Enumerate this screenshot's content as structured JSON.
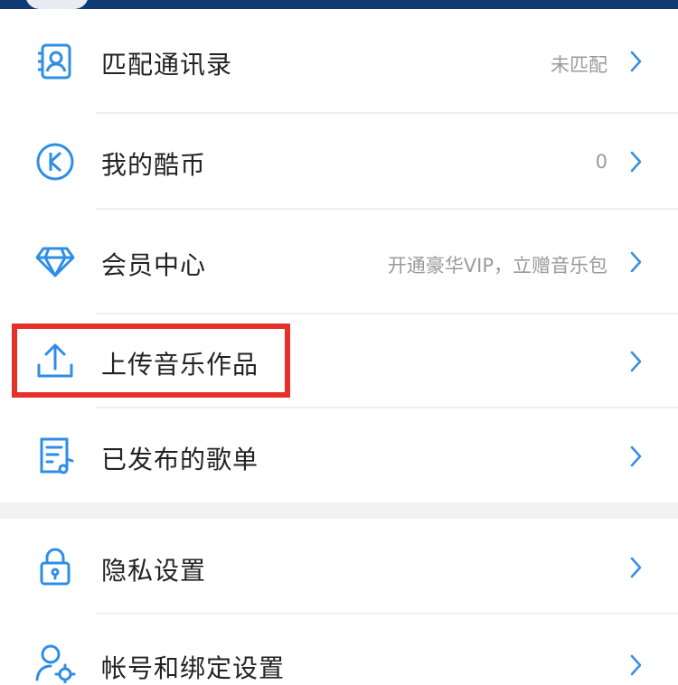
{
  "menu": {
    "items": [
      {
        "label": "匹配通讯录",
        "value": "未匹配",
        "icon": "contacts-icon"
      },
      {
        "label": "我的酷币",
        "value": "0",
        "icon": "kcoin-icon"
      },
      {
        "label": "会员中心",
        "value": "开通豪华VIP，立赠音乐包",
        "icon": "diamond-icon"
      },
      {
        "label": "上传音乐作品",
        "value": "",
        "icon": "upload-icon"
      },
      {
        "label": "已发布的歌单",
        "value": "",
        "icon": "playlist-icon"
      }
    ],
    "settings": [
      {
        "label": "隐私设置",
        "value": "",
        "icon": "lock-icon"
      },
      {
        "label": "帐号和绑定设置",
        "value": "",
        "icon": "account-settings-icon"
      }
    ]
  },
  "colors": {
    "accent": "#2e8ee6",
    "highlight_box": "#e8302a",
    "header": "#0f3a72",
    "label_text": "#222222",
    "value_text": "#9a9a9a",
    "chevron": "#3a8fe0"
  }
}
